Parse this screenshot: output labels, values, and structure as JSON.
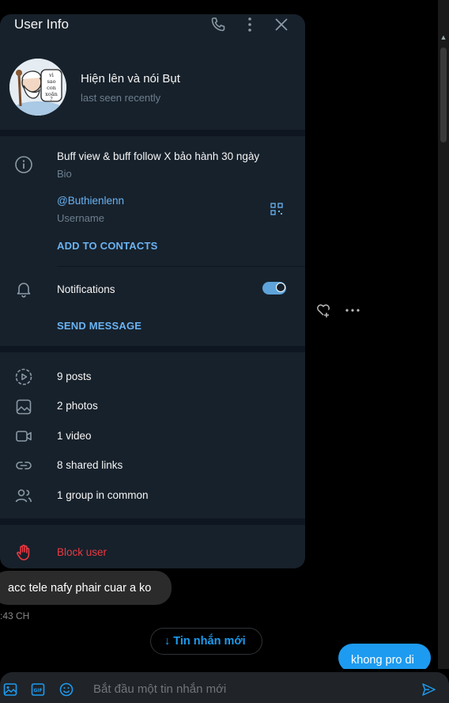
{
  "header": {
    "title": "User Info"
  },
  "profile": {
    "name": "Hiện lên và nói Bụt",
    "status": "last seen recently"
  },
  "info": {
    "bio_text": "Buff view & buff follow X bảo hành 30 ngày",
    "bio_label": "Bio",
    "username": "@Buthienlenn",
    "username_label": "Username",
    "add_contacts": "ADD TO CONTACTS",
    "notifications_label": "Notifications",
    "notifications_on": true,
    "send_message": "SEND MESSAGE"
  },
  "media": {
    "posts": "9 posts",
    "photos": "2 photos",
    "video": "1 video",
    "links": "8 shared links",
    "groups": "1 group in common"
  },
  "block": {
    "label": "Block user"
  },
  "chat": {
    "incoming_message": "acc tele nafy phair cuar a ko",
    "incoming_time": ":43 CH",
    "new_messages_button": "↓ Tin nhắn mới",
    "outgoing_message": "khong pro di",
    "composer_placeholder": "Bắt đầu một tin nhắn mới"
  },
  "colors": {
    "panel_bg": "#17212b",
    "accent_blue": "#6ab3f3",
    "danger_red": "#ec3942",
    "x_blue": "#1d9bf0"
  }
}
